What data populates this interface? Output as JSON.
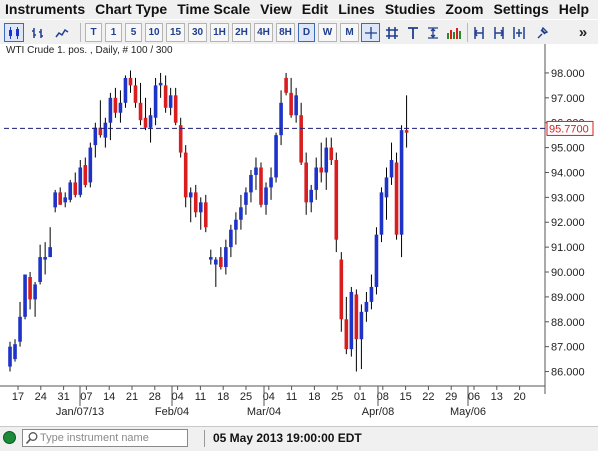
{
  "menu": [
    "Instruments",
    "Chart Type",
    "Time Scale",
    "View",
    "Edit",
    "Lines",
    "Studies",
    "Zoom",
    "Settings",
    "Help"
  ],
  "toolbar": {
    "timeframes": [
      "T",
      "1",
      "5",
      "10",
      "15",
      "30",
      "1H",
      "2H",
      "4H",
      "8H",
      "D",
      "W",
      "M"
    ],
    "selected_timeframe": "D",
    "overflow": "»"
  },
  "chart_header": "WTI Crude 1. pos. , Daily, # 100 / 300",
  "current_price": "95.7700",
  "colors": {
    "up": "#1e33c8",
    "down": "#d81e1e",
    "wick": "#000000",
    "price_line": "#1a1a7a",
    "price_tag": "#d81e1e"
  },
  "chart_data": {
    "type": "candlestick",
    "ylim": [
      85.5,
      98.6
    ],
    "y_ticks": [
      "98.000",
      "97.000",
      "96.000",
      "95.000",
      "94.000",
      "93.000",
      "92.000",
      "91.000",
      "90.000",
      "89.000",
      "88.000",
      "87.000",
      "86.000"
    ],
    "x_ticks": [
      "17",
      "24",
      "31",
      "07",
      "14",
      "21",
      "28",
      "04",
      "11",
      "18",
      "25",
      "04",
      "11",
      "18",
      "25",
      "01",
      "08",
      "15",
      "22",
      "29",
      "06",
      "13",
      "20"
    ],
    "x_major": [
      "Jan/07/13",
      "Feb/04",
      "Mar/04",
      "Apr/08",
      "May/06"
    ],
    "candles": [
      {
        "o": 86.2,
        "h": 87.2,
        "l": 86.0,
        "c": 87.0
      },
      {
        "o": 86.5,
        "h": 87.3,
        "l": 86.4,
        "c": 87.1
      },
      {
        "o": 87.2,
        "h": 88.8,
        "l": 87.0,
        "c": 88.2
      },
      {
        "o": 88.2,
        "h": 89.9,
        "l": 88.1,
        "c": 89.9
      },
      {
        "o": 89.8,
        "h": 90.0,
        "l": 88.5,
        "c": 88.9
      },
      {
        "o": 88.9,
        "h": 89.6,
        "l": 88.2,
        "c": 89.5
      },
      {
        "o": 89.6,
        "h": 91.1,
        "l": 89.5,
        "c": 90.6
      },
      {
        "o": 90.5,
        "h": 91.2,
        "l": 89.9,
        "c": 90.6
      },
      {
        "o": 90.6,
        "h": 91.8,
        "l": 90.6,
        "c": 91.0
      },
      {
        "o": 92.6,
        "h": 93.3,
        "l": 92.4,
        "c": 93.2
      },
      {
        "o": 93.2,
        "h": 93.4,
        "l": 92.7,
        "c": 92.7
      },
      {
        "o": 92.8,
        "h": 93.2,
        "l": 92.6,
        "c": 93.0
      },
      {
        "o": 92.9,
        "h": 93.7,
        "l": 92.8,
        "c": 93.6
      },
      {
        "o": 93.6,
        "h": 94.0,
        "l": 93.0,
        "c": 93.1
      },
      {
        "o": 93.1,
        "h": 94.5,
        "l": 93.0,
        "c": 94.2
      },
      {
        "o": 94.3,
        "h": 94.6,
        "l": 93.4,
        "c": 93.5
      },
      {
        "o": 93.6,
        "h": 95.2,
        "l": 93.4,
        "c": 95.0
      },
      {
        "o": 95.1,
        "h": 96.0,
        "l": 94.6,
        "c": 95.8
      },
      {
        "o": 95.8,
        "h": 96.9,
        "l": 95.4,
        "c": 95.5
      },
      {
        "o": 95.4,
        "h": 96.2,
        "l": 95.0,
        "c": 96.0
      },
      {
        "o": 96.0,
        "h": 97.2,
        "l": 95.3,
        "c": 97.0
      },
      {
        "o": 97.0,
        "h": 97.4,
        "l": 96.2,
        "c": 96.4
      },
      {
        "o": 96.4,
        "h": 97.3,
        "l": 96.0,
        "c": 96.8
      },
      {
        "o": 96.8,
        "h": 97.9,
        "l": 96.6,
        "c": 97.8
      },
      {
        "o": 97.8,
        "h": 98.1,
        "l": 97.2,
        "c": 97.5
      },
      {
        "o": 97.5,
        "h": 97.8,
        "l": 96.6,
        "c": 96.8
      },
      {
        "o": 96.8,
        "h": 97.6,
        "l": 95.9,
        "c": 96.1
      },
      {
        "o": 96.2,
        "h": 97.0,
        "l": 95.7,
        "c": 95.8
      },
      {
        "o": 95.8,
        "h": 96.6,
        "l": 95.2,
        "c": 96.3
      },
      {
        "o": 96.2,
        "h": 97.8,
        "l": 95.9,
        "c": 97.5
      },
      {
        "o": 97.5,
        "h": 98.0,
        "l": 97.0,
        "c": 97.6
      },
      {
        "o": 97.5,
        "h": 97.9,
        "l": 96.4,
        "c": 96.6
      },
      {
        "o": 96.6,
        "h": 97.4,
        "l": 96.3,
        "c": 97.1
      },
      {
        "o": 97.1,
        "h": 97.4,
        "l": 95.9,
        "c": 96.0
      },
      {
        "o": 95.9,
        "h": 96.2,
        "l": 94.6,
        "c": 94.8
      },
      {
        "o": 94.8,
        "h": 95.1,
        "l": 92.6,
        "c": 93.0
      },
      {
        "o": 93.0,
        "h": 93.4,
        "l": 92.0,
        "c": 93.2
      },
      {
        "o": 93.2,
        "h": 93.5,
        "l": 92.2,
        "c": 92.4
      },
      {
        "o": 92.4,
        "h": 93.0,
        "l": 91.7,
        "c": 92.8
      },
      {
        "o": 92.8,
        "h": 93.1,
        "l": 91.6,
        "c": 91.8
      },
      {
        "o": 90.5,
        "h": 90.9,
        "l": 90.3,
        "c": 90.6
      },
      {
        "o": 90.3,
        "h": 90.6,
        "l": 89.4,
        "c": 90.5
      },
      {
        "o": 90.6,
        "h": 91.0,
        "l": 90.1,
        "c": 90.2
      },
      {
        "o": 90.2,
        "h": 91.3,
        "l": 89.9,
        "c": 91.0
      },
      {
        "o": 91.0,
        "h": 91.9,
        "l": 90.6,
        "c": 91.7
      },
      {
        "o": 91.7,
        "h": 92.4,
        "l": 91.1,
        "c": 92.1
      },
      {
        "o": 92.1,
        "h": 93.1,
        "l": 91.7,
        "c": 92.6
      },
      {
        "o": 92.7,
        "h": 93.4,
        "l": 92.3,
        "c": 93.2
      },
      {
        "o": 93.2,
        "h": 94.1,
        "l": 92.8,
        "c": 93.9
      },
      {
        "o": 93.9,
        "h": 94.6,
        "l": 93.3,
        "c": 94.2
      },
      {
        "o": 94.2,
        "h": 94.4,
        "l": 92.6,
        "c": 92.7
      },
      {
        "o": 92.7,
        "h": 93.6,
        "l": 92.3,
        "c": 93.4
      },
      {
        "o": 93.4,
        "h": 94.2,
        "l": 92.9,
        "c": 93.8
      },
      {
        "o": 93.8,
        "h": 95.6,
        "l": 93.6,
        "c": 95.5
      },
      {
        "o": 95.5,
        "h": 97.3,
        "l": 95.1,
        "c": 96.8
      },
      {
        "o": 97.8,
        "h": 98.0,
        "l": 97.1,
        "c": 97.2
      },
      {
        "o": 97.2,
        "h": 97.8,
        "l": 96.2,
        "c": 96.3
      },
      {
        "o": 96.3,
        "h": 97.4,
        "l": 96.0,
        "c": 97.1
      },
      {
        "o": 96.3,
        "h": 96.8,
        "l": 94.3,
        "c": 94.4
      },
      {
        "o": 94.4,
        "h": 94.8,
        "l": 92.3,
        "c": 92.8
      },
      {
        "o": 92.8,
        "h": 93.5,
        "l": 92.4,
        "c": 93.3
      },
      {
        "o": 93.3,
        "h": 94.6,
        "l": 92.9,
        "c": 94.2
      },
      {
        "o": 94.2,
        "h": 95.2,
        "l": 93.6,
        "c": 94.0
      },
      {
        "o": 94.0,
        "h": 95.4,
        "l": 93.3,
        "c": 95.0
      },
      {
        "o": 95.0,
        "h": 95.4,
        "l": 94.3,
        "c": 94.5
      },
      {
        "o": 94.5,
        "h": 94.8,
        "l": 90.8,
        "c": 91.3
      },
      {
        "o": 90.5,
        "h": 90.8,
        "l": 87.6,
        "c": 88.1
      },
      {
        "o": 88.1,
        "h": 89.0,
        "l": 86.7,
        "c": 86.9
      },
      {
        "o": 86.9,
        "h": 89.4,
        "l": 86.6,
        "c": 89.2
      },
      {
        "o": 89.1,
        "h": 89.3,
        "l": 86.0,
        "c": 87.3
      },
      {
        "o": 87.3,
        "h": 88.7,
        "l": 86.1,
        "c": 88.4
      },
      {
        "o": 88.4,
        "h": 89.2,
        "l": 88.0,
        "c": 88.8
      },
      {
        "o": 88.8,
        "h": 89.9,
        "l": 88.5,
        "c": 89.4
      },
      {
        "o": 89.4,
        "h": 91.8,
        "l": 89.1,
        "c": 91.5
      },
      {
        "o": 91.5,
        "h": 93.4,
        "l": 91.2,
        "c": 93.2
      },
      {
        "o": 93.0,
        "h": 94.2,
        "l": 92.1,
        "c": 93.8
      },
      {
        "o": 93.8,
        "h": 95.2,
        "l": 93.5,
        "c": 94.5
      },
      {
        "o": 94.4,
        "h": 94.8,
        "l": 91.3,
        "c": 91.5
      },
      {
        "o": 91.5,
        "h": 95.9,
        "l": 90.6,
        "c": 95.7
      },
      {
        "o": 95.7,
        "h": 97.1,
        "l": 95.0,
        "c": 95.6
      }
    ]
  },
  "status": {
    "search_placeholder": "Type instrument name",
    "datetime": "05 May 2013 19:00:00 EDT"
  }
}
